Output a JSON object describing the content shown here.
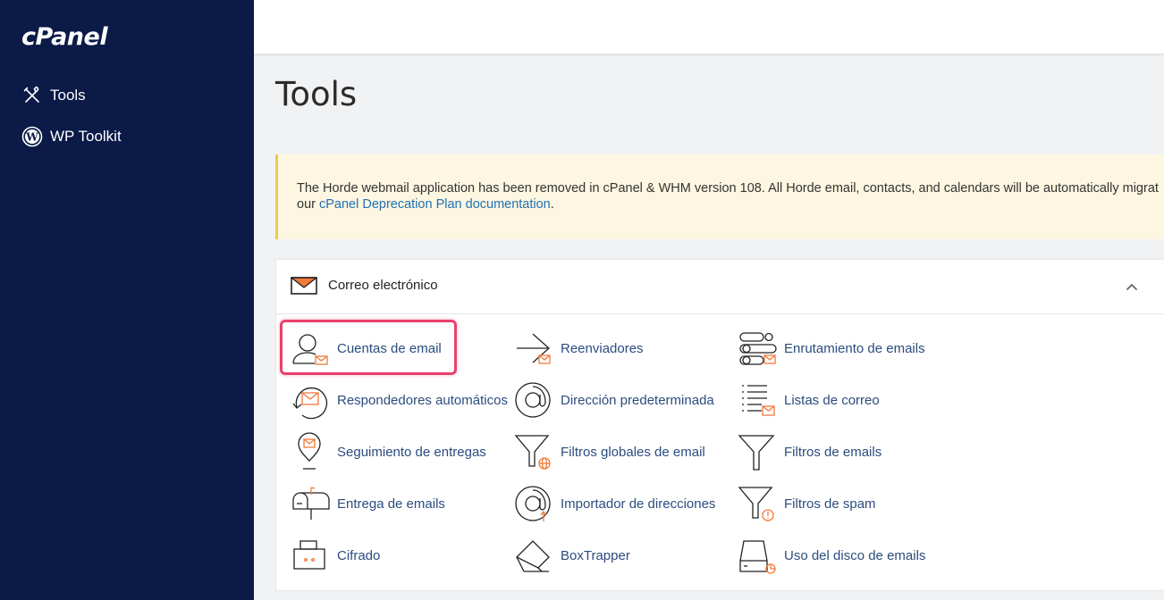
{
  "sidebar": {
    "logo": "cPanel",
    "items": [
      {
        "label": "Tools",
        "icon": "tools-icon"
      },
      {
        "label": "WP Toolkit",
        "icon": "wordpress-icon"
      }
    ]
  },
  "main": {
    "title": "Tools",
    "notice": {
      "text": "The Horde webmail application has been removed in cPanel & WHM version 108. All Horde email, contacts, and calendars will be automatically migrat",
      "prefix": "our ",
      "link": "cPanel Deprecation Plan documentation",
      "suffix": "."
    },
    "email_section": {
      "title": "Correo electrónico",
      "tools": [
        {
          "label": "Cuentas de email",
          "icon": "email-accounts-icon"
        },
        {
          "label": "Reenviadores",
          "icon": "forwarders-icon"
        },
        {
          "label": "Enrutamiento de emails",
          "icon": "email-routing-icon"
        },
        {
          "label": "Respondedores automáticos",
          "icon": "autoresponders-icon"
        },
        {
          "label": "Dirección predeterminada",
          "icon": "default-address-icon"
        },
        {
          "label": "Listas de correo",
          "icon": "mailing-lists-icon"
        },
        {
          "label": "Seguimiento de entregas",
          "icon": "track-delivery-icon"
        },
        {
          "label": "Filtros globales de email",
          "icon": "global-email-filters-icon"
        },
        {
          "label": "Filtros de emails",
          "icon": "email-filters-icon"
        },
        {
          "label": "Entrega de emails",
          "icon": "email-deliverability-icon"
        },
        {
          "label": "Importador de direcciones",
          "icon": "address-importer-icon"
        },
        {
          "label": "Filtros de spam",
          "icon": "spam-filters-icon"
        },
        {
          "label": "Cifrado",
          "icon": "encryption-icon"
        },
        {
          "label": "BoxTrapper",
          "icon": "boxtrapper-icon"
        },
        {
          "label": "Uso del disco de emails",
          "icon": "email-disk-usage-icon"
        }
      ]
    }
  },
  "colors": {
    "sidebar_bg": "#0b1a47",
    "accent_orange": "#f07a3a",
    "link_blue": "#2b4c7e",
    "notice_bg": "#fdf7e1",
    "highlight": "#e8416c"
  }
}
